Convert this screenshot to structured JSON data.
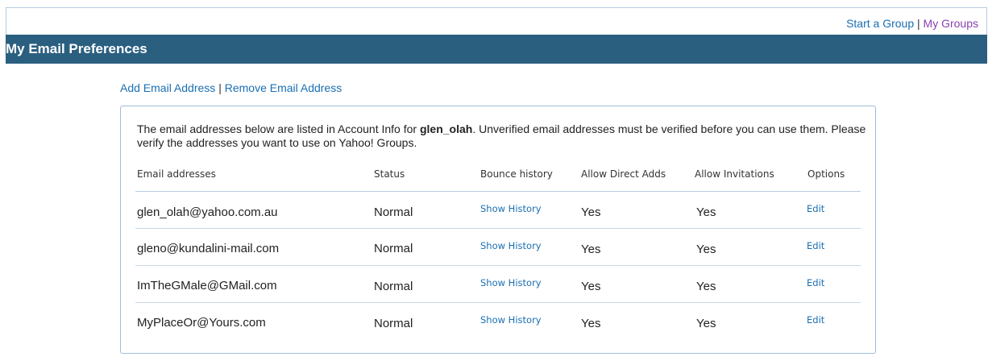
{
  "top_nav": {
    "start_group": "Start a Group",
    "separator": "|",
    "my_groups": "My Groups"
  },
  "page": {
    "title": "My Email Preferences"
  },
  "email_actions": {
    "add": "Add Email Address",
    "separator": "|",
    "remove": "Remove Email Address"
  },
  "intro": {
    "before_user": "The email addresses below are listed in Account Info for ",
    "username": "glen_olah",
    "after_user": ". Unverified email addresses must be verified before you can use them. Please verify the addresses you want to use on Yahoo! Groups."
  },
  "table": {
    "headers": [
      "Email addresses",
      "Status",
      "Bounce history",
      "Allow Direct Adds",
      "Allow Invitations",
      "Options"
    ],
    "rows": [
      {
        "email": "glen_olah@yahoo.com.au",
        "status": "Normal",
        "bounce": "Show History",
        "direct_adds": "Yes",
        "invitations": "Yes",
        "option": "Edit"
      },
      {
        "email": "gleno@kundalini-mail.com",
        "status": "Normal",
        "bounce": "Show History",
        "direct_adds": "Yes",
        "invitations": "Yes",
        "option": "Edit"
      },
      {
        "email": "ImTheGMale@GMail.com",
        "status": "Normal",
        "bounce": "Show History",
        "direct_adds": "Yes",
        "invitations": "Yes",
        "option": "Edit"
      },
      {
        "email": "MyPlaceOr@Yours.com",
        "status": "Normal",
        "bounce": "Show History",
        "direct_adds": "Yes",
        "invitations": "Yes",
        "option": "Edit"
      }
    ]
  },
  "colors": {
    "header_bar": "#2b5f80",
    "link": "#1a6fb3",
    "visited_link": "#8c3fb0",
    "panel_border": "#9fbcdb"
  }
}
